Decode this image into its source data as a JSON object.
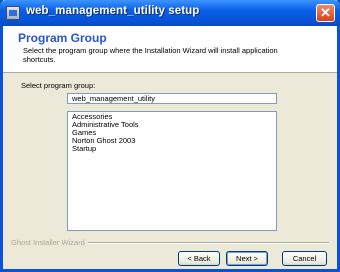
{
  "window": {
    "title": "web_management_utility setup",
    "close_glyph": "✕",
    "title_bar_color": "#0a5fe6",
    "close_color": "#d2421b"
  },
  "header": {
    "title": "Program Group",
    "description": "Select the program group where the Installation Wizard will install application shortcuts.",
    "title_color": "#2a56c5"
  },
  "form": {
    "group_label": "Select program group:",
    "group_value": "web_management_utility",
    "groups": [
      "Accessories",
      "Administrative Tools",
      "Games",
      "Norton Ghost 2003",
      "Startup"
    ]
  },
  "footer": {
    "wizard_label": "Ghost Installer Wizard",
    "back_label": "< Back",
    "next_label": "Next >",
    "cancel_label": "Cancel"
  },
  "icons": {
    "app": "app-icon",
    "close": "close-icon"
  }
}
